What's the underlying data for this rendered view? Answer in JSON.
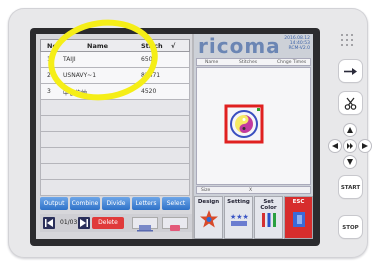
{
  "brand": "ricoma",
  "datetime": [
    "2016.08.12",
    "14:40:53",
    "RCM-V2.0"
  ],
  "design_table": {
    "headers": {
      "no": "No.",
      "name": "Name",
      "stitch": "Stitch",
      "check": "√"
    },
    "rows": [
      {
        "no": "1",
        "name": "TAIJI",
        "stitch": "6501"
      },
      {
        "no": "2",
        "name": "USNAVY~1",
        "stitch": "85471"
      },
      {
        "no": "3",
        "name": "中佳伯纳",
        "stitch": "4520"
      }
    ]
  },
  "tabs": [
    "Output",
    "Combine",
    "Divide",
    "Letters",
    "Select"
  ],
  "pager": {
    "page": "01/03",
    "delete_label": "Delete"
  },
  "right_table": {
    "headers": {
      "name": "Name",
      "stitches": "Stitches",
      "change_times": "Chnge Times"
    }
  },
  "size_bar": {
    "size_label": "Size",
    "x_label": "X"
  },
  "actions": {
    "design": "Design",
    "setting": "Setting",
    "set_color": "Set Color",
    "exit": "ESC"
  },
  "hardware": {
    "start": "START",
    "stop": "STOP"
  },
  "colors": {
    "accent": "#2f72c8",
    "delete": "#e03a3a",
    "annotation": "#f5ee17",
    "brand": "#6b86b4"
  }
}
